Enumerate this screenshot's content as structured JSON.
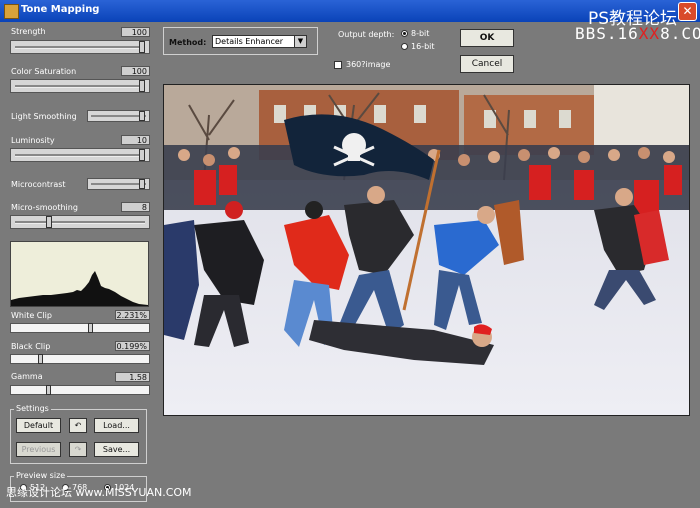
{
  "window": {
    "title": "Tone Mapping",
    "close_glyph": "✕"
  },
  "watermark": {
    "line1": "PS教程论坛",
    "line2_a": "BBS.16",
    "line2_b": "XX",
    "line2_c": "8.COM",
    "bottom": "思缘设计论坛 www.MISSYUAN.COM"
  },
  "controls": {
    "strength": {
      "label": "Strength",
      "value": "100",
      "level": 1.0
    },
    "color_saturation": {
      "label": "Color Saturation",
      "value": "100",
      "level": 1.0
    },
    "light_smoothing": {
      "label": "Light Smoothing",
      "level": 1.0
    },
    "luminosity": {
      "label": "Luminosity",
      "value": "10",
      "level": 1.0
    },
    "microcontrast": {
      "label": "Microcontrast",
      "level": 1.0
    },
    "micro_smoothing": {
      "label": "Micro-smoothing",
      "value": "8",
      "level": 0.27
    },
    "white_clip": {
      "label": "White Clip",
      "value": "2.231%",
      "level": 0.58
    },
    "black_clip": {
      "label": "Black Clip",
      "value": "0.199%",
      "level": 0.2
    },
    "gamma": {
      "label": "Gamma",
      "value": "1.58",
      "level": 0.26
    }
  },
  "settings": {
    "title": "Settings",
    "default_label": "Default",
    "load_label": "Load...",
    "previous_label": "Previous",
    "save_label": "Save..."
  },
  "preview_size": {
    "title": "Preview size",
    "options": [
      "512",
      "768",
      "1024"
    ]
  },
  "method": {
    "label": "Method:",
    "selected": "Details Enhancer"
  },
  "output_depth": {
    "label": "Output depth:",
    "opt8": "8-bit",
    "opt16": "16-bit",
    "selected": "8-bit"
  },
  "image360": {
    "label": "360?image"
  },
  "buttons": {
    "ok": "OK",
    "cancel": "Cancel"
  }
}
